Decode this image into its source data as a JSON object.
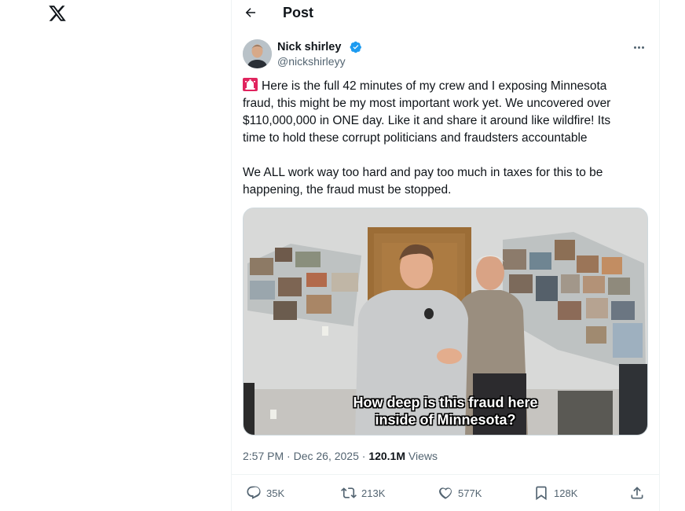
{
  "brand": {
    "logo_icon": "x-logo-icon"
  },
  "header": {
    "back_icon": "arrow-left-icon",
    "title": "Post"
  },
  "post": {
    "author": {
      "name": "Nick shirley",
      "handle": "@nickshirleyy",
      "verified": true,
      "verified_color": "#1d9bf0"
    },
    "text_lines": [
      "Here is the full 42 minutes of my crew and I exposing Minnesota",
      "fraud, this might be my most important work yet. We uncovered over",
      "$110,000,000 in ONE day. Like it and share it around like wildfire! Its",
      "time to hold these corrupt politicians and fraudsters accountable"
    ],
    "text_lines_2": [
      "We ALL work way too hard and pay too much in taxes for this to be",
      "happening, the fraud must be stopped."
    ],
    "emoji_icon": "police-siren-icon",
    "video": {
      "caption_line_1": "How deep is this fraud here",
      "caption_line_2": "inside of Minnesota?"
    },
    "timestamp": "2:57 PM · Dec 26, 2025 · ",
    "views_count": "120.1M",
    "views_label": " Views",
    "actions": {
      "reply": {
        "icon": "reply-icon",
        "count": "35K"
      },
      "repost": {
        "icon": "repost-icon",
        "count": "213K"
      },
      "like": {
        "icon": "heart-icon",
        "count": "577K"
      },
      "bookmark": {
        "icon": "bookmark-icon",
        "count": "128K"
      },
      "share": {
        "icon": "share-icon"
      }
    }
  },
  "colors": {
    "text": "#0f1419",
    "secondary": "#536471",
    "border": "#eff3f4",
    "accent": "#1d9bf0"
  }
}
